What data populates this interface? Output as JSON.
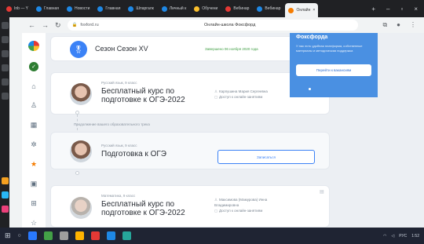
{
  "browser": {
    "tabs": [
      {
        "label": "Inb — Y",
        "color": "#e53935"
      },
      {
        "label": "Главная",
        "color": "#1e88e5"
      },
      {
        "label": "Новости",
        "color": "#1e88e5"
      },
      {
        "label": "Главная",
        "color": "#1e88e5"
      },
      {
        "label": "Шпаргалк",
        "color": "#1e88e5"
      },
      {
        "label": "Личный к",
        "color": "#1e88e5"
      },
      {
        "label": "Обучени",
        "color": "#fbc02d"
      },
      {
        "label": "Вебинар",
        "color": "#e53935"
      },
      {
        "label": "Вебинар",
        "color": "#1e88e5"
      },
      {
        "label": "Онлайн",
        "color": "#f57c00"
      }
    ],
    "address": "foxford.ru",
    "site_title": "Онлайн-школа Фоксфорд"
  },
  "season_card": {
    "title": "Сезон Сезон XV",
    "status": "Завершено 06 ноября 2020 года"
  },
  "courses": [
    {
      "subject": "Русский язык, 9 класс",
      "title_line1": "Бесплатный курс по",
      "title_line2": "подготовке к ОГЭ-2022",
      "teacher": "Карпушина Мария Сергеевна",
      "access": "Доступ к онлайн-занятиям"
    },
    {
      "subject": "Русский язык, 9 класс",
      "title_line1": "Подготовка к ОГЭ",
      "button": "Записаться"
    },
    {
      "subject": "Математика, 9 класс",
      "title_line1": "Бесплатный курс по",
      "title_line2": "подготовке к ОГЭ-2022",
      "teacher": "Максимова (Мамурова) Инна Владимировна",
      "access": "Доступ к онлайн-занятиям"
    }
  ],
  "continue_label": "Продолжение вашего образовательного трека",
  "promo": {
    "heading": "Фоксфорда",
    "text": "У нас есть удобная платформа, собственные материалы и методическая поддержка",
    "button": "Перейти к вакансиям"
  },
  "taskbar": {
    "time": "1:52",
    "lang": "РУС"
  }
}
